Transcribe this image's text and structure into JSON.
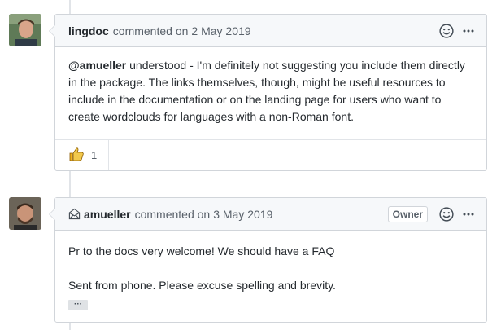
{
  "comments": [
    {
      "author": "lingdoc",
      "action": "commented on",
      "date": "2 May 2019",
      "body": {
        "mention": "@amueller",
        "text": " understood - I'm definitely not suggesting you include them directly in the package. The links themselves, though, might be useful resources to include in the documentation or on the landing page for users who want to create wordclouds for languages with a non-Roman font."
      },
      "reactions": [
        {
          "icon": "thumbs-up-icon",
          "count": "1"
        }
      ]
    },
    {
      "author": "amueller",
      "action": "commented on",
      "date": "3 May 2019",
      "badge": "Owner",
      "via_icon": "email-icon",
      "body": {
        "line1": "Pr to the docs very welcome! We should have a FAQ",
        "line2": "Sent from phone. Please excuse spelling and brevity.",
        "expand_label": "···"
      }
    }
  ],
  "colors": {
    "border": "#d1d5da",
    "header_bg": "#f6f8fa",
    "text": "#24292e",
    "muted": "#586069"
  }
}
